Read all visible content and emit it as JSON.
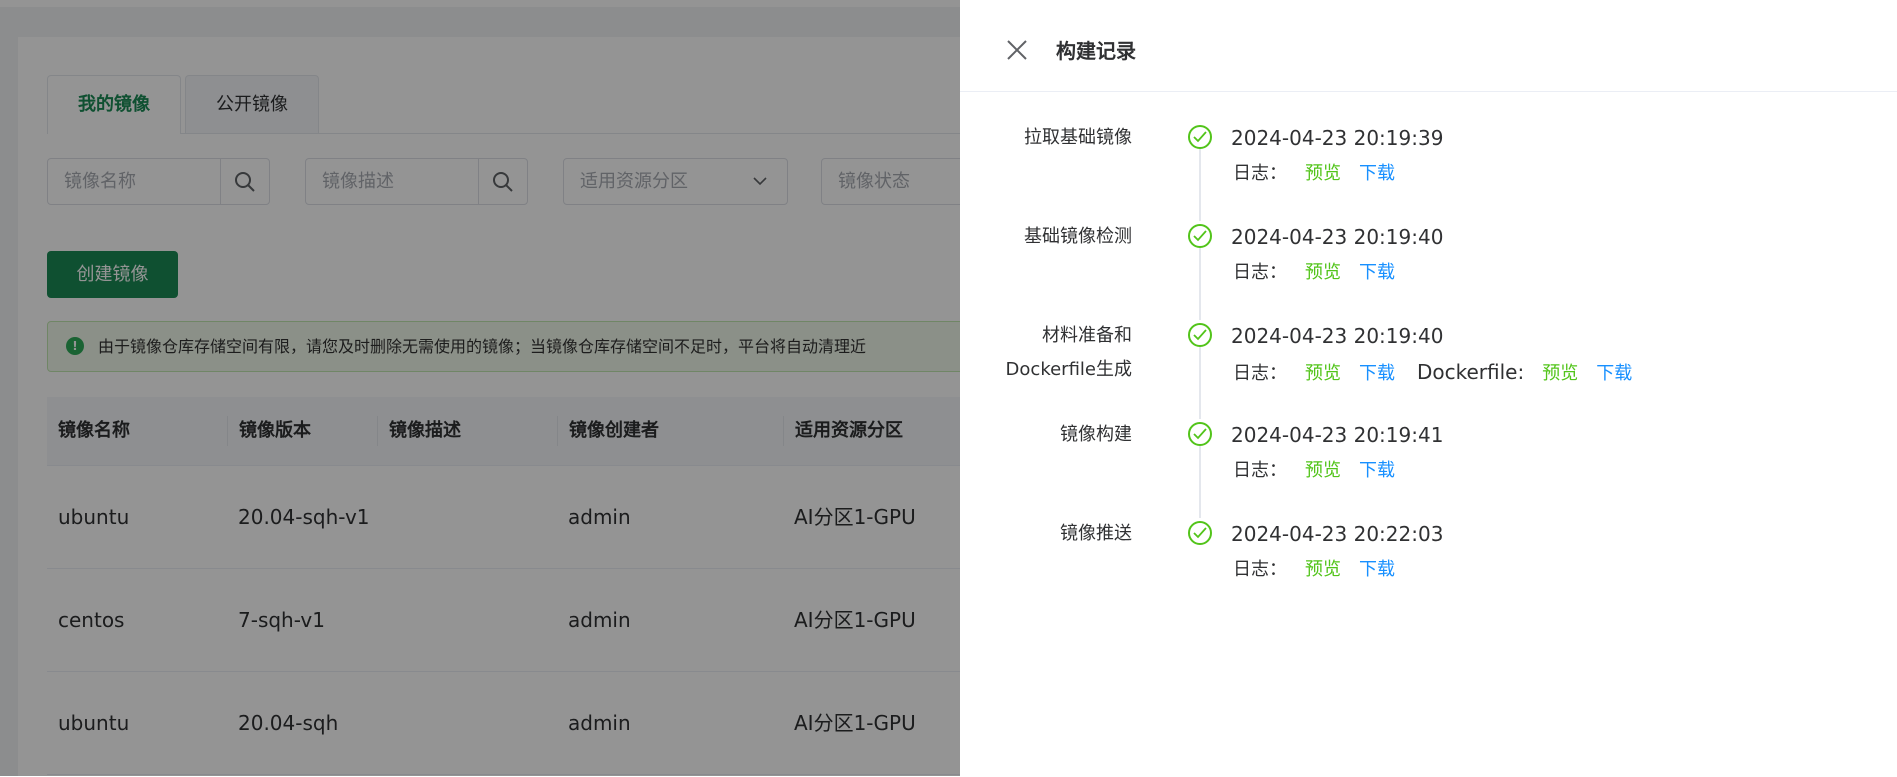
{
  "tabs": [
    {
      "label": "我的镜像"
    },
    {
      "label": "公开镜像"
    }
  ],
  "filters": {
    "name_placeholder": "镜像名称",
    "desc_placeholder": "镜像描述",
    "partition_placeholder": "适用资源分区",
    "status_placeholder": "镜像状态"
  },
  "create_button": "创建镜像",
  "alert_text": "由于镜像仓库存储空间有限，请您及时删除无需使用的镜像；当镜像仓库存储空间不足时，平台将自动清理近",
  "table": {
    "headers": [
      "镜像名称",
      "镜像版本",
      "镜像描述",
      "镜像创建者",
      "适用资源分区"
    ],
    "rows": [
      [
        "ubuntu",
        "20.04-sqh-v1",
        "",
        "admin",
        "AI分区1-GPU"
      ],
      [
        "centos",
        "7-sqh-v1",
        "",
        "admin",
        "AI分区1-GPU"
      ],
      [
        "ubuntu",
        "20.04-sqh",
        "",
        "admin",
        "AI分区1-GPU"
      ]
    ]
  },
  "drawer": {
    "title": "构建记录",
    "log_key": "日志：",
    "preview": "预览",
    "download": "下载",
    "dockerfile_key": "Dockerfile:",
    "steps": [
      {
        "label": "拉取基础镜像",
        "time": "2024-04-23 20:19:39"
      },
      {
        "label": "基础镜像检测",
        "time": "2024-04-23 20:19:40"
      },
      {
        "label": "材料准备和",
        "label2": "Dockerfile生成",
        "time": "2024-04-23 20:19:40"
      },
      {
        "label": "镜像构建",
        "time": "2024-04-23 20:19:41"
      },
      {
        "label": "镜像推送",
        "time": "2024-04-23 20:22:03"
      }
    ]
  },
  "colors": {
    "brand": "#1a8a55",
    "success": "#52c41a",
    "link": "#1890ff"
  }
}
